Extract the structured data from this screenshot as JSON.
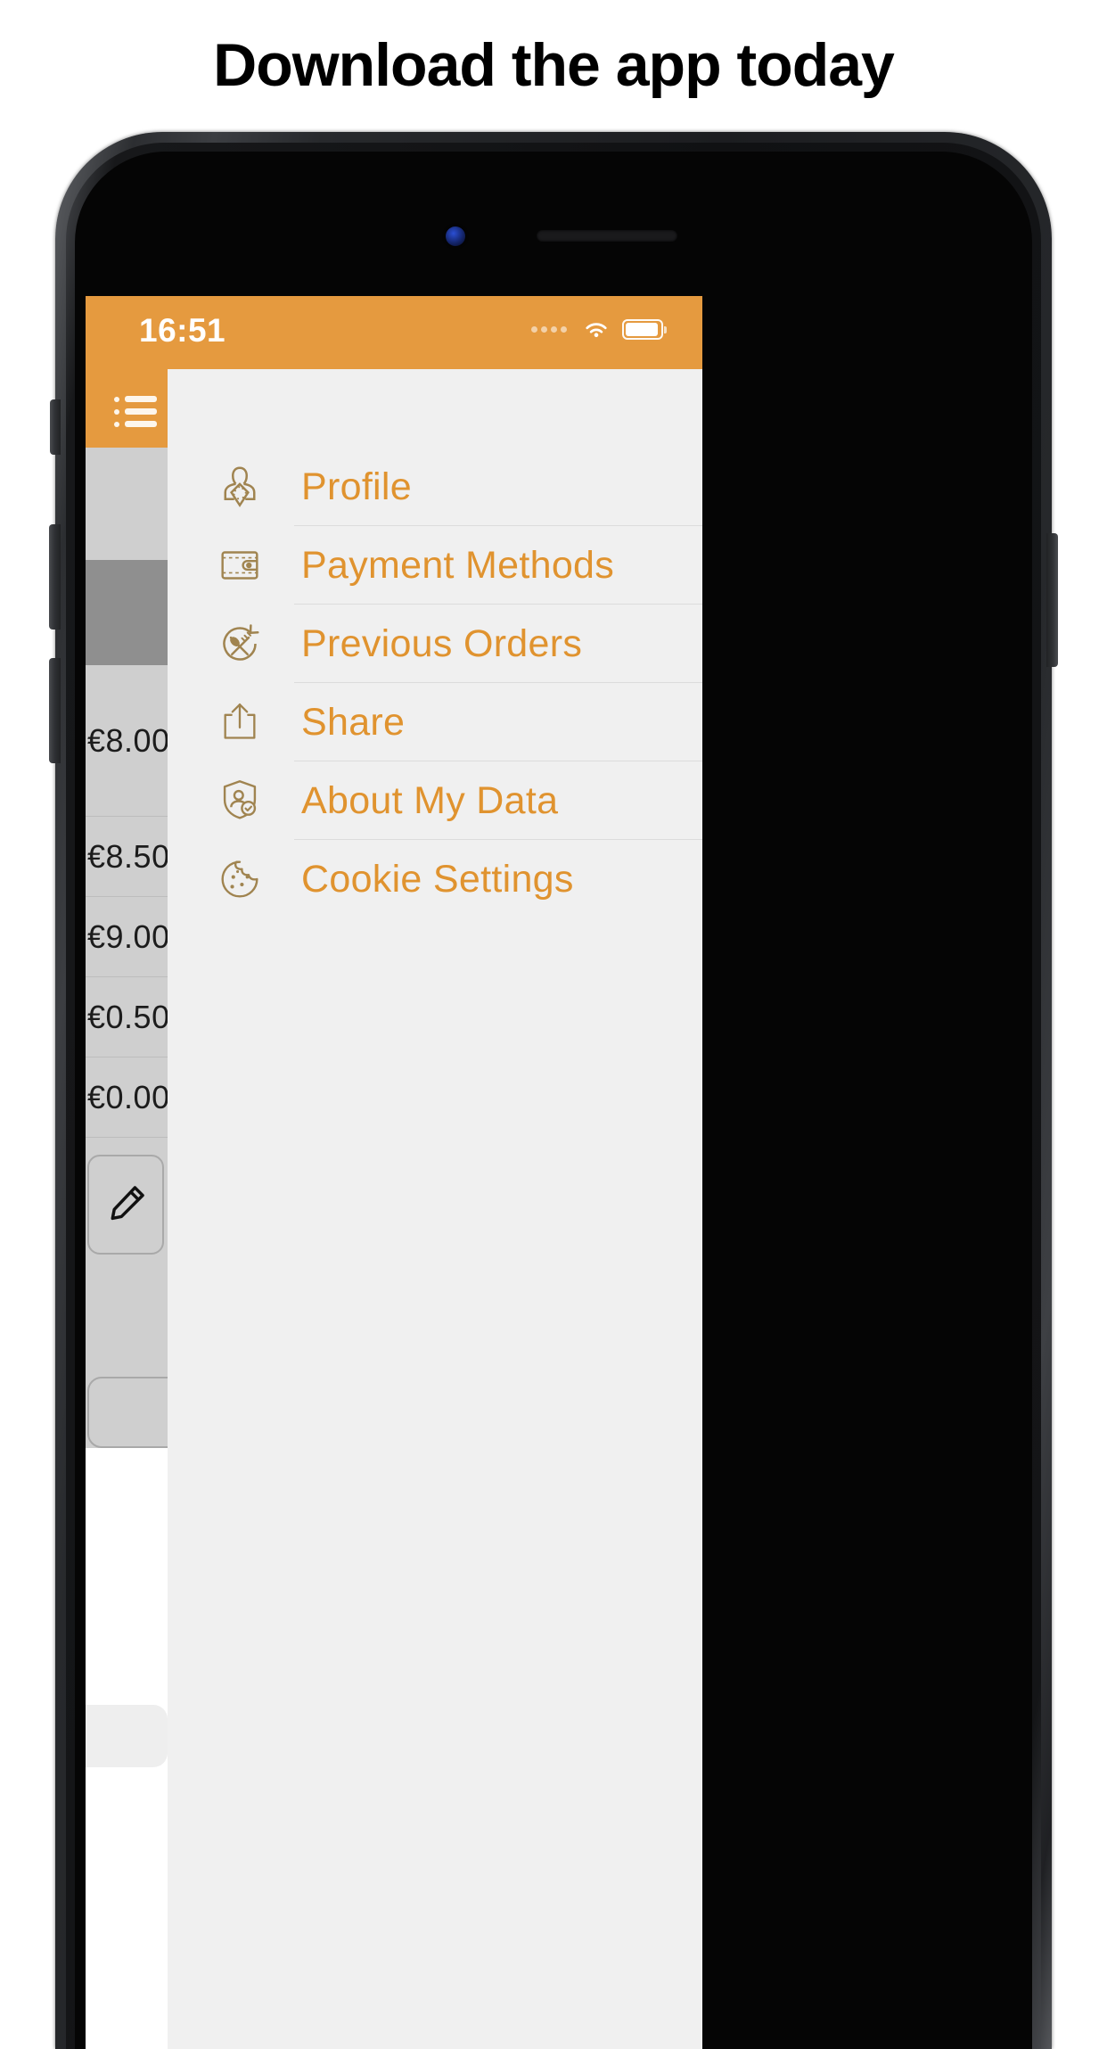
{
  "headline": "Download the app today",
  "colors": {
    "brand_orange": "#E59A3F",
    "menu_label": "#E0932F",
    "icon_gold": "#A08450",
    "drawer_bg": "#F0F0F0"
  },
  "status_bar": {
    "time": "16:51",
    "signal_icon": "signal-dots-icon",
    "wifi_icon": "wifi-icon",
    "battery_icon": "battery-icon"
  },
  "nav_bar": {
    "menu_button_icon": "hamburger-menu-icon"
  },
  "drawer": {
    "items": [
      {
        "label": "Profile",
        "icon": "profile-person-napkin-icon"
      },
      {
        "label": "Payment Methods",
        "icon": "wallet-icon"
      },
      {
        "label": "Previous Orders",
        "icon": "cutlery-refresh-icon"
      },
      {
        "label": "Share",
        "icon": "share-upload-icon"
      },
      {
        "label": "About My Data",
        "icon": "shield-person-check-icon"
      },
      {
        "label": "Cookie Settings",
        "icon": "cookie-icon"
      }
    ]
  },
  "background_content": {
    "rows": [
      {
        "value": "",
        "state": "normal"
      },
      {
        "value": "",
        "state": "selected"
      },
      {
        "value": "€8.00",
        "state": "normal"
      },
      {
        "value": "€8.50",
        "state": "normal"
      },
      {
        "value": "€9.00",
        "state": "normal"
      },
      {
        "value": "€0.50",
        "state": "normal"
      },
      {
        "value": "€0.00",
        "state": "normal"
      }
    ],
    "edit_button_icon": "pencil-icon"
  }
}
